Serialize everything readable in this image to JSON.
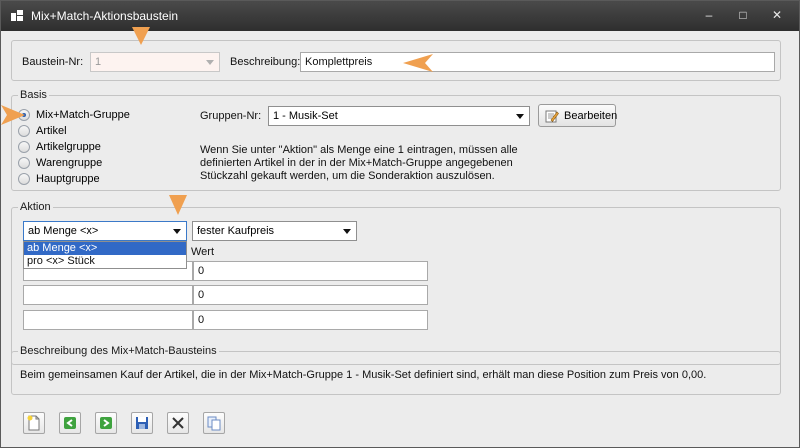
{
  "window": {
    "title": "Mix+Match-Aktionsbaustein",
    "controls": {
      "minimize": "–",
      "maximize": "□",
      "close": "✕"
    }
  },
  "header": {
    "baustein_label": "Baustein-Nr:",
    "baustein_value": "1",
    "beschreibung_label": "Beschreibung:",
    "beschreibung_value": "Komplettpreis"
  },
  "basis": {
    "legend": "Basis",
    "options": [
      {
        "label": "Mix+Match-Gruppe",
        "checked": true
      },
      {
        "label": "Artikel",
        "checked": false
      },
      {
        "label": "Artikelgruppe",
        "checked": false
      },
      {
        "label": "Warengruppe",
        "checked": false
      },
      {
        "label": "Hauptgruppe",
        "checked": false
      }
    ],
    "gruppen_label": "Gruppen-Nr:",
    "gruppen_value": "1 - Musik-Set",
    "bearbeiten_label": "Bearbeiten",
    "info_lines": [
      "Wenn Sie unter \"Aktion\" als Menge eine 1 eintragen, müssen alle",
      "definierten Artikel in der in der Mix+Match-Gruppe angegebenen",
      "Stückzahl gekauft werden, um die Sonderaktion auszulösen."
    ]
  },
  "aktion": {
    "legend": "Aktion",
    "mode_value": "ab Menge <x>",
    "mode_options": [
      "ab Menge <x>",
      "pro <x> Stück"
    ],
    "price_type_value": "fester Kaufpreis",
    "wert_label": "Wert",
    "rows": [
      {
        "menge": "",
        "wert": "0"
      },
      {
        "menge": "",
        "wert": "0"
      },
      {
        "menge": "",
        "wert": "0"
      }
    ]
  },
  "beschreibung_box": {
    "legend": "Beschreibung des Mix+Match-Bausteins",
    "text": "Beim gemeinsamen Kauf der Artikel, die in der Mix+Match-Gruppe 1 - Musik-Set definiert sind, erhält man diese Position zum Preis von 0,00."
  },
  "toolbar": {
    "buttons": [
      "new-icon",
      "back-icon",
      "forward-icon",
      "save-icon",
      "delete-icon",
      "copy-icon"
    ]
  },
  "colors": {
    "titlebar": "#2e2e2e",
    "marker": "#f0a050",
    "selection": "#3169c6"
  }
}
